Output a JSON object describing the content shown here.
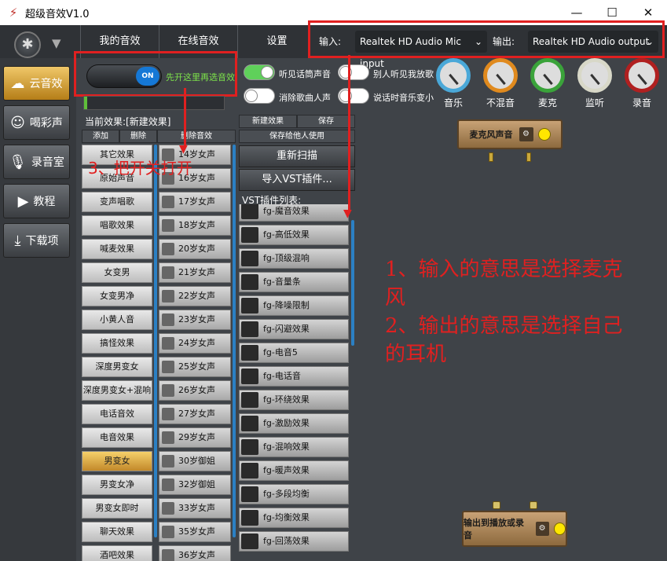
{
  "window": {
    "title": "超级音效V1.0",
    "minimize": "—",
    "maximize": "☐",
    "close": "✕"
  },
  "nav": {
    "tabs": [
      "我的音效",
      "在线音效",
      "设置"
    ],
    "dropdown_arrow": "▼"
  },
  "io": {
    "input_label": "输入:",
    "input_value": "Realtek HD Audio Mic input",
    "output_label": "输出:",
    "output_value": "Realtek HD Audio output"
  },
  "sidebar": {
    "items": [
      "云音效",
      "喝彩声",
      "录音室",
      "教程",
      "下载项"
    ],
    "active": "云音效",
    "icons": [
      "cloud-icon",
      "mask-icon",
      "mic-icon",
      "play-icon",
      "download-icon"
    ]
  },
  "power": {
    "label": "ON",
    "hint": "先开这里再选音效",
    "on": true
  },
  "options": [
    {
      "label": "听见话筒声音",
      "on": true
    },
    {
      "label": "别人听见我放歌",
      "on": false
    },
    {
      "label": "消除歌曲人声",
      "on": false
    },
    {
      "label": "说话时音乐变小",
      "on": false
    }
  ],
  "knobs": [
    {
      "label": "音乐",
      "color": "#4aa8d8"
    },
    {
      "label": "不混音",
      "color": "#e08a1e"
    },
    {
      "label": "麦克",
      "color": "#3aa33a"
    },
    {
      "label": "监听",
      "color": "#d8d8c8"
    },
    {
      "label": "录音",
      "color": "#b02020"
    }
  ],
  "current_effect_label": "当前效果:[新建效果]",
  "left_buttons": {
    "add": "添加",
    "delete": "删除",
    "delete_effect": "删除音效"
  },
  "effects_list": [
    "其它效果",
    "原始声音",
    "变声唱歌",
    "唱歌效果",
    "喊麦效果",
    "女变男",
    "女变男净",
    "小黄人音",
    "搞怪效果",
    "深度男变女",
    "深度男变女+混响",
    "电话音效",
    "电音效果",
    "男变女",
    "男变女净",
    "男变女即时",
    "聊天效果",
    "酒吧效果"
  ],
  "selected_effect": "男变女",
  "voices_list": [
    "14岁女声",
    "16岁女声",
    "17岁女声",
    "18岁女声",
    "20岁女声",
    "21岁女声",
    "22岁女声",
    "23岁女声",
    "24岁女声",
    "25岁女声",
    "26岁女声",
    "27岁女声",
    "29岁女声",
    "30岁御姐",
    "32岁御姐",
    "33岁女声",
    "35岁女声",
    "36岁女声"
  ],
  "mid_buttons": {
    "new_effect": "新建效果",
    "save": "保存",
    "save_personal": "保存给他人使用",
    "rescan": "重新扫描",
    "import_vst": "导入VST插件...",
    "vst_list_label": "VST插件列表:"
  },
  "vst_list": [
    "fg-魔音效果",
    "fg-高低效果",
    "fg-顶级混响",
    "fg-音量条",
    "fg-降噪限制",
    "fg-闪避效果",
    "fg-电音5",
    "fg-电话音",
    "fg-环绕效果",
    "fg-激励效果",
    "fg-混响效果",
    "fg-暖声效果",
    "fg-多段均衡",
    "fg-均衡效果",
    "fg-回荡效果"
  ],
  "canvas": {
    "mic_node": "麦克风声音",
    "output_node": "输出到播放或录音",
    "sliders_icon": "⚙"
  },
  "annotations": {
    "step3": "3、把开关打开",
    "note1a": "1、输入的意思是选择麦克",
    "note1b": "风",
    "note2a": "2、输出的意思是选择自己",
    "note2b": "的耳机"
  }
}
